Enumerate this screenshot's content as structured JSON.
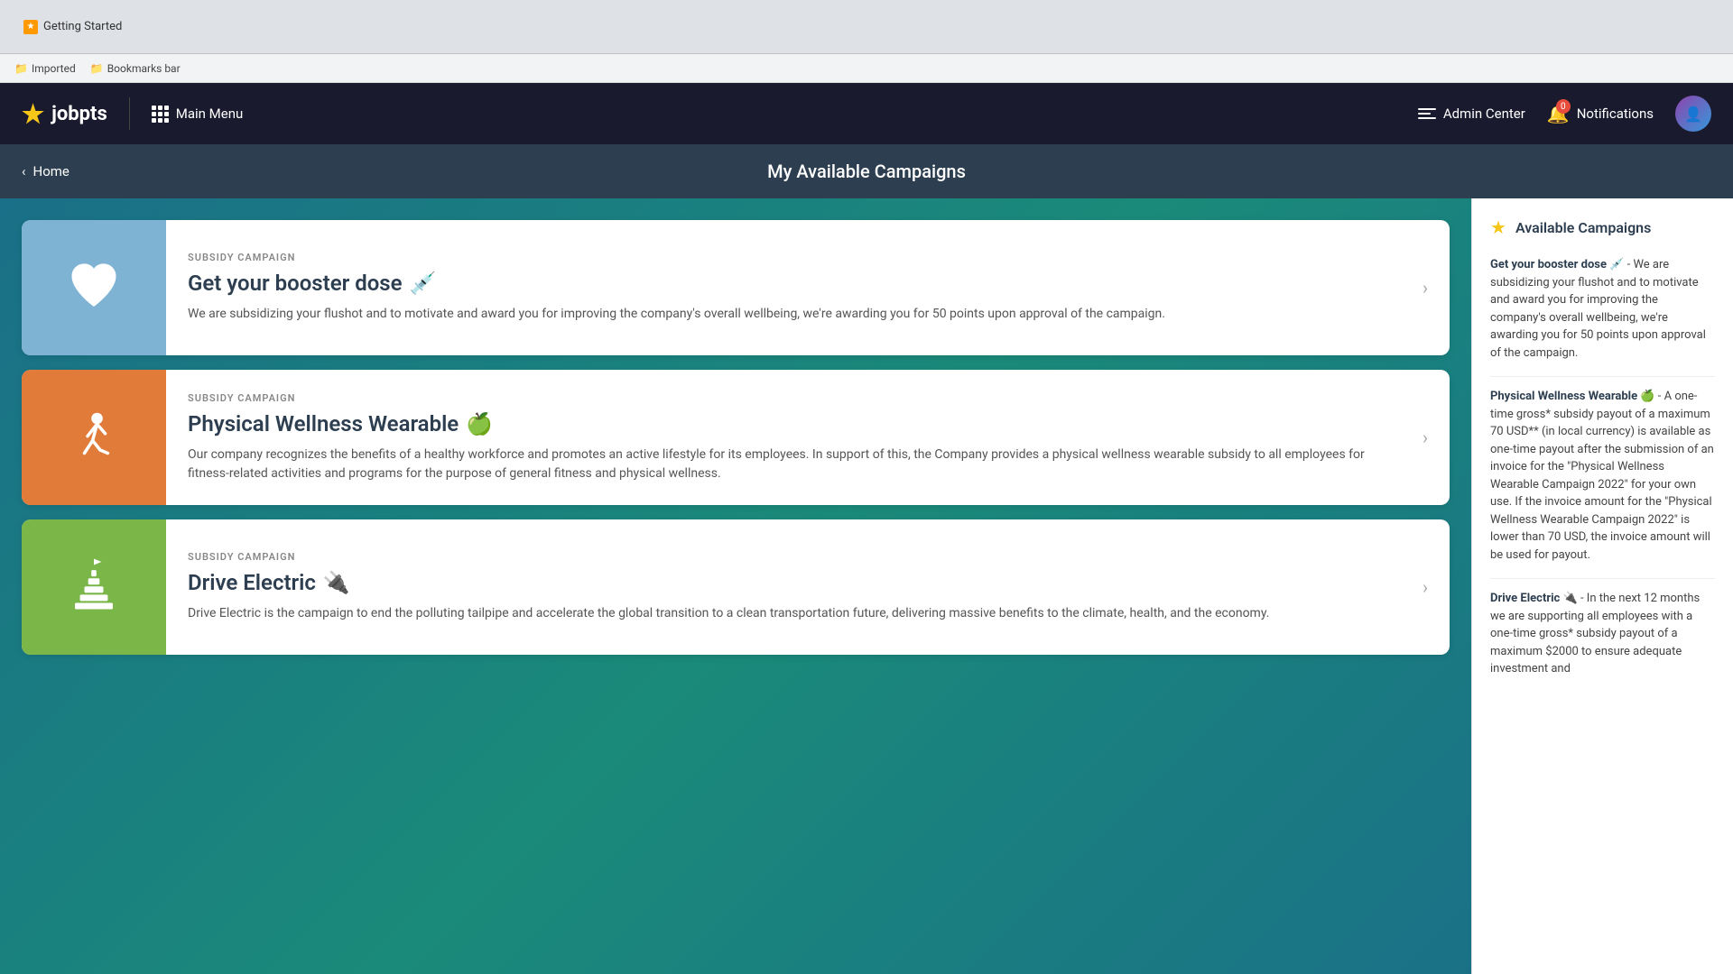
{
  "browser": {
    "tab_label": "Getting Started",
    "bookmarks": [
      {
        "label": "Imported",
        "icon": "📁"
      },
      {
        "label": "Bookmarks bar",
        "icon": "📁"
      }
    ]
  },
  "header": {
    "logo_text": "jobpts",
    "main_menu_label": "Main Menu",
    "admin_center_label": "Admin Center",
    "notifications_label": "Notifications",
    "notifications_count": "0"
  },
  "page_header": {
    "back_label": "Home",
    "title": "My Available Campaigns"
  },
  "campaigns": [
    {
      "type": "SUBSIDY CAMPAIGN",
      "name": "Get your booster dose",
      "emoji": "💉",
      "color": "blue",
      "icon_type": "heart",
      "description": "We are subsidizing your flushot and to motivate and award you for improving the company's overall wellbeing, we're awarding you for 50 points upon approval of the campaign."
    },
    {
      "type": "SUBSIDY CAMPAIGN",
      "name": "Physical Wellness Wearable",
      "emoji": "🍏",
      "color": "orange",
      "icon_type": "runner",
      "description": "Our company recognizes the benefits of a healthy workforce and promotes an active lifestyle for its employees. In support of this, the Company provides a physical wellness wearable subsidy to all employees for fitness-related activities and programs for the purpose of general fitness and physical wellness."
    },
    {
      "type": "SUBSIDY CAMPAIGN",
      "name": "Drive Electric",
      "emoji": "🔌",
      "color": "green",
      "icon_type": "tower",
      "description": "Drive Electric is the campaign to end the polluting tailpipe and accelerate the global transition to a clean transportation future, delivering massive benefits to the climate, health, and the economy."
    }
  ],
  "sidebar": {
    "title": "Available Campaigns",
    "items": [
      {
        "title": "Get your booster dose 💉",
        "description": " - We are subsidizing your flushot and to motivate and award you for improving the company's overall wellbeing, we're awarding you for 50 points upon approval of the campaign."
      },
      {
        "title": "Physical Wellness Wearable 🍏",
        "description": " - A one-time gross* subsidy payout of a maximum 70 USD** (in local currency) is available as one-time payout after the submission of an invoice for the \"Physical Wellness Wearable Campaign 2022\" for your own use. If the invoice amount for the \"Physical Wellness Wearable Campaign 2022\" is lower than 70 USD, the invoice amount will be used for payout."
      },
      {
        "title": "Drive Electric 🔌",
        "description": " - In the next 12 months we are supporting all employees with a one-time gross* subsidy payout of a maximum $2000 to ensure adequate investment and"
      }
    ]
  }
}
